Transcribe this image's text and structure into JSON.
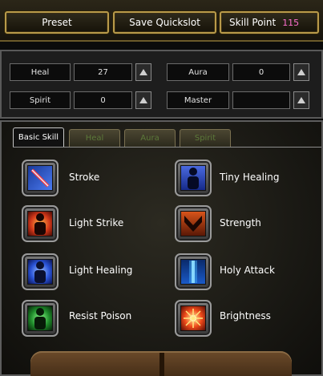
{
  "topbar": {
    "preset_label": "Preset",
    "save_quickslot_label": "Save Quickslot",
    "skill_point_label": "Skill Point",
    "skill_point_value": "115"
  },
  "stats": {
    "heal_label": "Heal",
    "heal_value": "27",
    "aura_label": "Aura",
    "aura_value": "0",
    "spirit_label": "Spirit",
    "spirit_value": "0",
    "master_label": "Master",
    "master_value": ""
  },
  "tabs": [
    "Basic Skill",
    "Heal",
    "Aura",
    "Spirit"
  ],
  "skills": [
    {
      "name": "Stroke",
      "icon": "sword-icon"
    },
    {
      "name": "Tiny Healing",
      "icon": "tiny-healing-icon"
    },
    {
      "name": "Light Strike",
      "icon": "light-strike-icon"
    },
    {
      "name": "Strength",
      "icon": "strength-icon"
    },
    {
      "name": "Light Healing",
      "icon": "light-healing-icon"
    },
    {
      "name": "Holy Attack",
      "icon": "holy-attack-icon"
    },
    {
      "name": "Resist Poison",
      "icon": "resist-poison-icon"
    },
    {
      "name": "Brightness",
      "icon": "brightness-icon"
    }
  ],
  "colors": {
    "accent_gold": "#b89a4a",
    "skill_point_value": "#ff6fd0",
    "inactive_tab_text": "#5d7a3a"
  }
}
